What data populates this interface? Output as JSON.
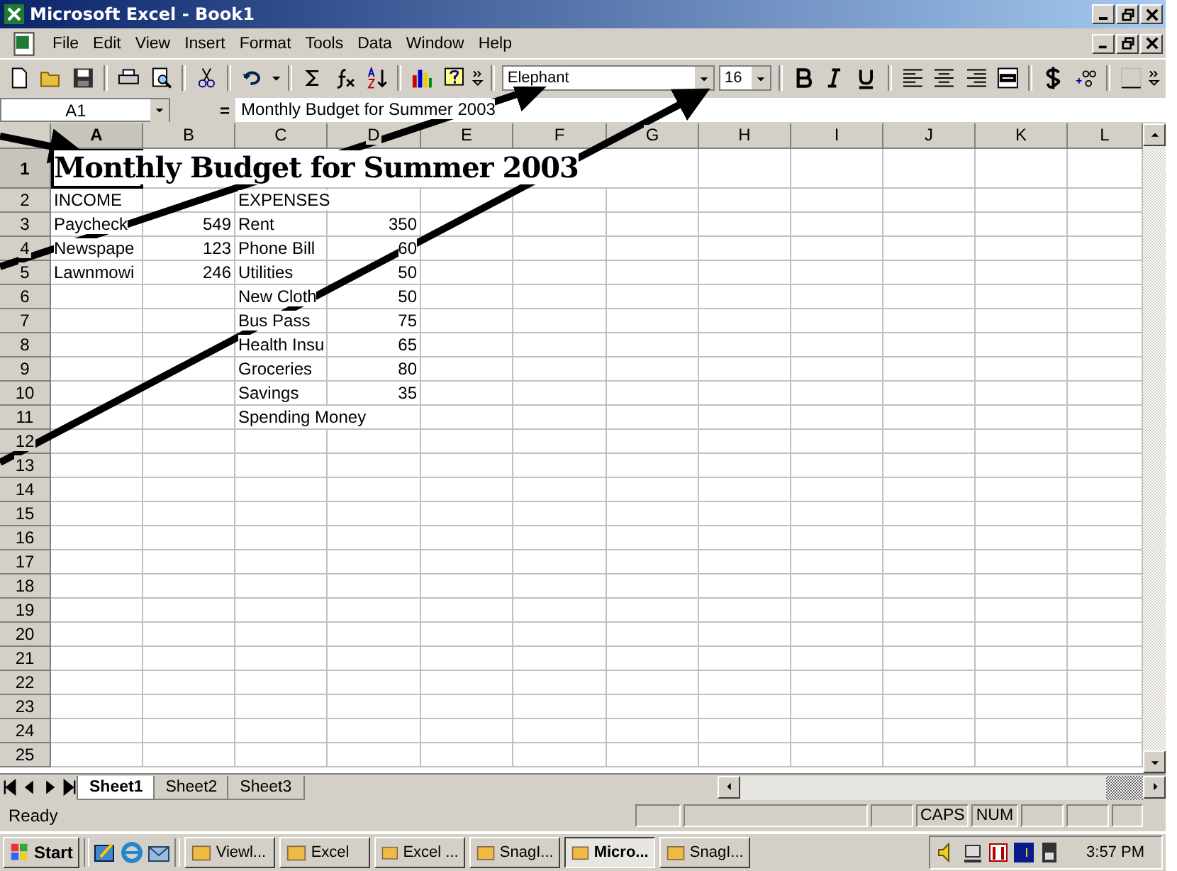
{
  "window": {
    "title": "Microsoft Excel - Book1"
  },
  "menu": [
    "File",
    "Edit",
    "View",
    "Insert",
    "Format",
    "Tools",
    "Data",
    "Window",
    "Help"
  ],
  "toolbar": {
    "font": "Elephant",
    "size": "16"
  },
  "formula_bar": {
    "name_box": "A1",
    "equals": "=",
    "value": "Monthly Budget for Summer 2003"
  },
  "columns": [
    {
      "label": "A",
      "selected": true
    },
    {
      "label": "B",
      "selected": false
    },
    {
      "label": "C",
      "selected": false
    },
    {
      "label": "D",
      "selected": false
    },
    {
      "label": "E",
      "selected": false
    },
    {
      "label": "F",
      "selected": false
    },
    {
      "label": "G",
      "selected": false
    },
    {
      "label": "H",
      "selected": false
    },
    {
      "label": "I",
      "selected": false
    },
    {
      "label": "J",
      "selected": false
    },
    {
      "label": "K",
      "selected": false
    },
    {
      "label": "L",
      "selected": false
    }
  ],
  "rows": [
    {
      "number": "1",
      "selected": true,
      "kind": "title",
      "a": "Monthly Budget for Summer 2003"
    },
    {
      "number": "2",
      "selected": false,
      "a": "INCOME",
      "c": "EXPENSES"
    },
    {
      "number": "3",
      "selected": false,
      "a": "Paycheck",
      "b": "549",
      "c": "Rent",
      "d": "350"
    },
    {
      "number": "4",
      "selected": false,
      "a": "Newspape",
      "b": "123",
      "c": "Phone Bill",
      "d": "60"
    },
    {
      "number": "5",
      "selected": false,
      "a": "Lawnmowi",
      "b": "246",
      "c": "Utilities",
      "d": "50"
    },
    {
      "number": "6",
      "selected": false,
      "c": "New Cloth",
      "d": "50"
    },
    {
      "number": "7",
      "selected": false,
      "c": "Bus Pass",
      "d": "75"
    },
    {
      "number": "8",
      "selected": false,
      "c": "Health Insu",
      "d": "65"
    },
    {
      "number": "9",
      "selected": false,
      "c": "Groceries",
      "d": "80"
    },
    {
      "number": "10",
      "selected": false,
      "c": "Savings",
      "d": "35"
    },
    {
      "number": "11",
      "selected": false,
      "c": "Spending Money"
    },
    {
      "number": "12",
      "selected": false
    },
    {
      "number": "13",
      "selected": false
    },
    {
      "number": "14",
      "selected": false
    },
    {
      "number": "15",
      "selected": false
    },
    {
      "number": "16",
      "selected": false
    },
    {
      "number": "17",
      "selected": false
    },
    {
      "number": "18",
      "selected": false
    },
    {
      "number": "19",
      "selected": false
    },
    {
      "number": "20",
      "selected": false
    },
    {
      "number": "21",
      "selected": false
    },
    {
      "number": "22",
      "selected": false
    },
    {
      "number": "23",
      "selected": false
    },
    {
      "number": "24",
      "selected": false
    },
    {
      "number": "25",
      "selected": false
    }
  ],
  "sheet_tabs": [
    {
      "label": "Sheet1",
      "selected": true
    },
    {
      "label": "Sheet2",
      "selected": false
    },
    {
      "label": "Sheet3",
      "selected": false
    }
  ],
  "status_bar": {
    "text": "Ready",
    "indicators": [
      "CAPS",
      "NUM"
    ]
  },
  "taskbar": {
    "start": "Start",
    "tasks": [
      {
        "label": "Viewl...",
        "selected": false
      },
      {
        "label": "Excel",
        "selected": false
      },
      {
        "label": "Excel ...",
        "selected": false
      },
      {
        "label": "SnagI...",
        "selected": false
      },
      {
        "label": "Micro...",
        "selected": true
      },
      {
        "label": "SnagI...",
        "selected": false
      }
    ],
    "clock": "3:57 PM"
  }
}
